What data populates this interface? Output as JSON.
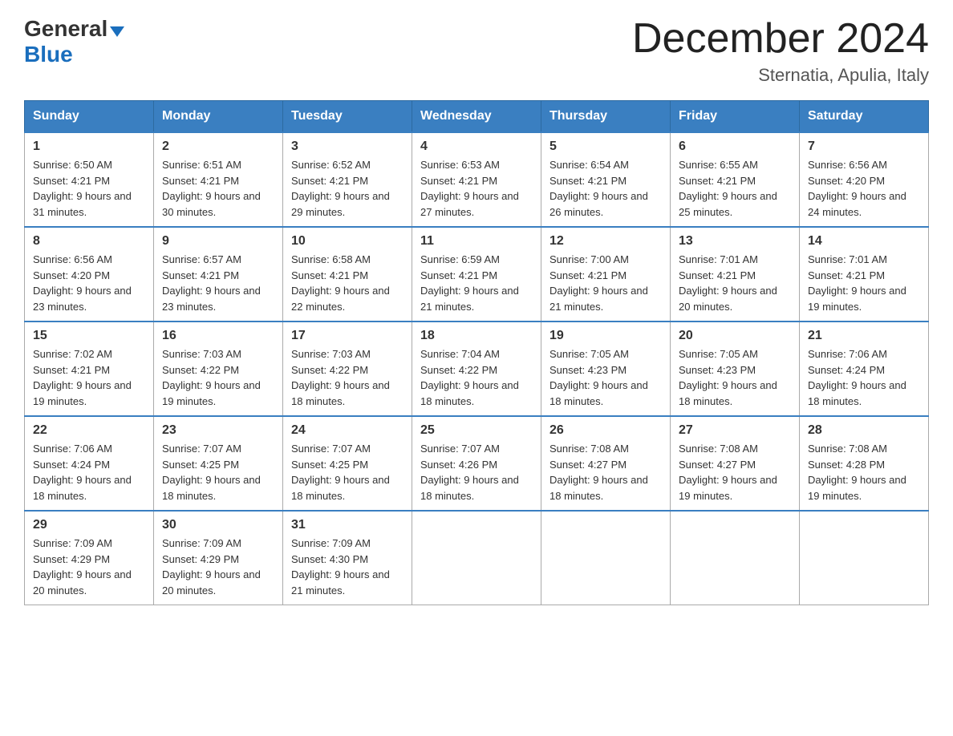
{
  "header": {
    "logo_general": "General",
    "logo_blue": "Blue",
    "main_title": "December 2024",
    "sub_title": "Sternatia, Apulia, Italy"
  },
  "days_of_week": [
    "Sunday",
    "Monday",
    "Tuesday",
    "Wednesday",
    "Thursday",
    "Friday",
    "Saturday"
  ],
  "weeks": [
    [
      {
        "day": "1",
        "sunrise": "6:50 AM",
        "sunset": "4:21 PM",
        "daylight": "9 hours and 31 minutes."
      },
      {
        "day": "2",
        "sunrise": "6:51 AM",
        "sunset": "4:21 PM",
        "daylight": "9 hours and 30 minutes."
      },
      {
        "day": "3",
        "sunrise": "6:52 AM",
        "sunset": "4:21 PM",
        "daylight": "9 hours and 29 minutes."
      },
      {
        "day": "4",
        "sunrise": "6:53 AM",
        "sunset": "4:21 PM",
        "daylight": "9 hours and 27 minutes."
      },
      {
        "day": "5",
        "sunrise": "6:54 AM",
        "sunset": "4:21 PM",
        "daylight": "9 hours and 26 minutes."
      },
      {
        "day": "6",
        "sunrise": "6:55 AM",
        "sunset": "4:21 PM",
        "daylight": "9 hours and 25 minutes."
      },
      {
        "day": "7",
        "sunrise": "6:56 AM",
        "sunset": "4:20 PM",
        "daylight": "9 hours and 24 minutes."
      }
    ],
    [
      {
        "day": "8",
        "sunrise": "6:56 AM",
        "sunset": "4:20 PM",
        "daylight": "9 hours and 23 minutes."
      },
      {
        "day": "9",
        "sunrise": "6:57 AM",
        "sunset": "4:21 PM",
        "daylight": "9 hours and 23 minutes."
      },
      {
        "day": "10",
        "sunrise": "6:58 AM",
        "sunset": "4:21 PM",
        "daylight": "9 hours and 22 minutes."
      },
      {
        "day": "11",
        "sunrise": "6:59 AM",
        "sunset": "4:21 PM",
        "daylight": "9 hours and 21 minutes."
      },
      {
        "day": "12",
        "sunrise": "7:00 AM",
        "sunset": "4:21 PM",
        "daylight": "9 hours and 21 minutes."
      },
      {
        "day": "13",
        "sunrise": "7:01 AM",
        "sunset": "4:21 PM",
        "daylight": "9 hours and 20 minutes."
      },
      {
        "day": "14",
        "sunrise": "7:01 AM",
        "sunset": "4:21 PM",
        "daylight": "9 hours and 19 minutes."
      }
    ],
    [
      {
        "day": "15",
        "sunrise": "7:02 AM",
        "sunset": "4:21 PM",
        "daylight": "9 hours and 19 minutes."
      },
      {
        "day": "16",
        "sunrise": "7:03 AM",
        "sunset": "4:22 PM",
        "daylight": "9 hours and 19 minutes."
      },
      {
        "day": "17",
        "sunrise": "7:03 AM",
        "sunset": "4:22 PM",
        "daylight": "9 hours and 18 minutes."
      },
      {
        "day": "18",
        "sunrise": "7:04 AM",
        "sunset": "4:22 PM",
        "daylight": "9 hours and 18 minutes."
      },
      {
        "day": "19",
        "sunrise": "7:05 AM",
        "sunset": "4:23 PM",
        "daylight": "9 hours and 18 minutes."
      },
      {
        "day": "20",
        "sunrise": "7:05 AM",
        "sunset": "4:23 PM",
        "daylight": "9 hours and 18 minutes."
      },
      {
        "day": "21",
        "sunrise": "7:06 AM",
        "sunset": "4:24 PM",
        "daylight": "9 hours and 18 minutes."
      }
    ],
    [
      {
        "day": "22",
        "sunrise": "7:06 AM",
        "sunset": "4:24 PM",
        "daylight": "9 hours and 18 minutes."
      },
      {
        "day": "23",
        "sunrise": "7:07 AM",
        "sunset": "4:25 PM",
        "daylight": "9 hours and 18 minutes."
      },
      {
        "day": "24",
        "sunrise": "7:07 AM",
        "sunset": "4:25 PM",
        "daylight": "9 hours and 18 minutes."
      },
      {
        "day": "25",
        "sunrise": "7:07 AM",
        "sunset": "4:26 PM",
        "daylight": "9 hours and 18 minutes."
      },
      {
        "day": "26",
        "sunrise": "7:08 AM",
        "sunset": "4:27 PM",
        "daylight": "9 hours and 18 minutes."
      },
      {
        "day": "27",
        "sunrise": "7:08 AM",
        "sunset": "4:27 PM",
        "daylight": "9 hours and 19 minutes."
      },
      {
        "day": "28",
        "sunrise": "7:08 AM",
        "sunset": "4:28 PM",
        "daylight": "9 hours and 19 minutes."
      }
    ],
    [
      {
        "day": "29",
        "sunrise": "7:09 AM",
        "sunset": "4:29 PM",
        "daylight": "9 hours and 20 minutes."
      },
      {
        "day": "30",
        "sunrise": "7:09 AM",
        "sunset": "4:29 PM",
        "daylight": "9 hours and 20 minutes."
      },
      {
        "day": "31",
        "sunrise": "7:09 AM",
        "sunset": "4:30 PM",
        "daylight": "9 hours and 21 minutes."
      },
      null,
      null,
      null,
      null
    ]
  ]
}
